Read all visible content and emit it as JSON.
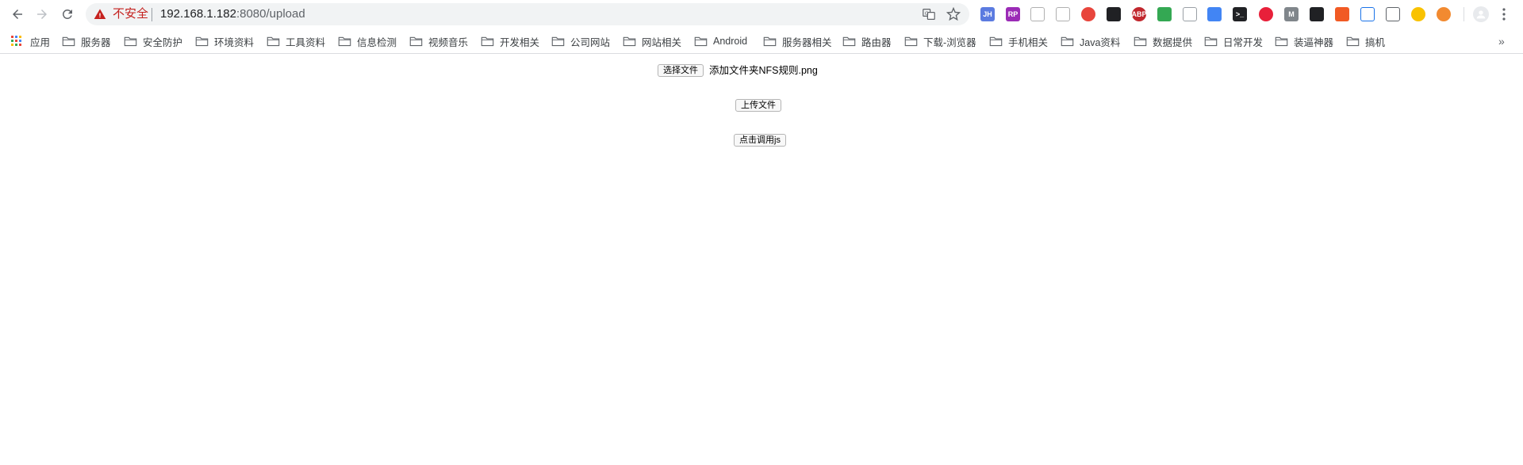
{
  "toolbar": {
    "security_label": "不安全",
    "url_host": "192.168.1.182",
    "url_rest": ":8080/upload"
  },
  "extensions": [
    {
      "name": "jh-extension-icon",
      "label": "JH",
      "color": "#5b7be0"
    },
    {
      "name": "jetbrains-extension-icon",
      "label": "RP",
      "color": "#9b2bb6"
    },
    {
      "name": "sitemap-extension-icon",
      "label": "",
      "color": "#b0b0b0"
    },
    {
      "name": "frame-extension-icon",
      "label": "",
      "color": "#b0b0b0"
    },
    {
      "name": "red-circle-extension-icon",
      "label": "",
      "color": "#e8453c"
    },
    {
      "name": "ghost-extension-icon",
      "label": "",
      "color": "#202124"
    },
    {
      "name": "adblock-plus-extension-icon",
      "label": "ABP",
      "color": "#c1272d"
    },
    {
      "name": "shield-extension-icon",
      "label": "",
      "color": "#34a853"
    },
    {
      "name": "fox-extension-icon",
      "label": "",
      "color": "#9aa0a6"
    },
    {
      "name": "chrome-extension-icon",
      "label": "",
      "color": "#4285f4"
    },
    {
      "name": "terminal-extension-icon",
      "label": ">_",
      "color": "#202124"
    },
    {
      "name": "youtube-extension-icon",
      "label": "",
      "color": "#e8203a"
    },
    {
      "name": "m-extension-icon",
      "label": "M",
      "color": "#80868b"
    },
    {
      "name": "square-extension-icon",
      "label": "",
      "color": "#202124"
    },
    {
      "name": "translate-extension-icon",
      "label": "",
      "color": "#f15a24"
    },
    {
      "name": "wave-extension-icon",
      "label": "",
      "color": "#1a73e8"
    },
    {
      "name": "eraser-extension-icon",
      "label": "",
      "color": "#5f6368"
    },
    {
      "name": "yellow-circle-extension-icon",
      "label": "",
      "color": "#f9c200"
    },
    {
      "name": "orange-x-extension-icon",
      "label": "",
      "color": "#f28a30"
    }
  ],
  "bookmarks": {
    "apps_label": "应用",
    "items": [
      "服务器",
      "安全防护",
      "环境资料",
      "工具资料",
      "信息检测",
      "视频音乐",
      "开发相关",
      "公司网站",
      "网站相关",
      "Android",
      "服务器相关",
      "路由器",
      "下载-浏览器",
      "手机相关",
      "Java资料",
      "数据提供",
      "日常开发",
      "装逼神器",
      "搞机"
    ],
    "more": "»"
  },
  "page": {
    "choose_file_label": "选择文件",
    "selected_file": "添加文件夹NFS规则.png",
    "upload_label": "上传文件",
    "call_js_label": "点击调用js"
  }
}
